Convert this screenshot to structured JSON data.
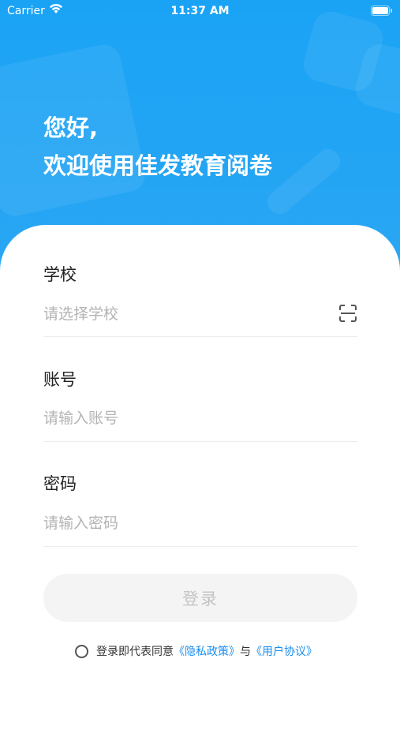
{
  "status_bar": {
    "carrier": "Carrier",
    "time": "11:37 AM"
  },
  "greeting": {
    "line1": "您好,",
    "line2": "欢迎使用佳发教育阅卷"
  },
  "form": {
    "school": {
      "label": "学校",
      "placeholder": "请选择学校",
      "icon": "scan-icon"
    },
    "account": {
      "label": "账号",
      "placeholder": "请输入账号"
    },
    "password": {
      "label": "密码",
      "placeholder": "请输入密码"
    }
  },
  "login_button": "登录",
  "agreement": {
    "prefix": "登录即代表同意",
    "privacy_link": "《隐私政策》",
    "and": "与",
    "user_link": "《用户协议》"
  },
  "colors": {
    "brand_blue": "#1aa3f5",
    "link": "#1a8ff0"
  }
}
